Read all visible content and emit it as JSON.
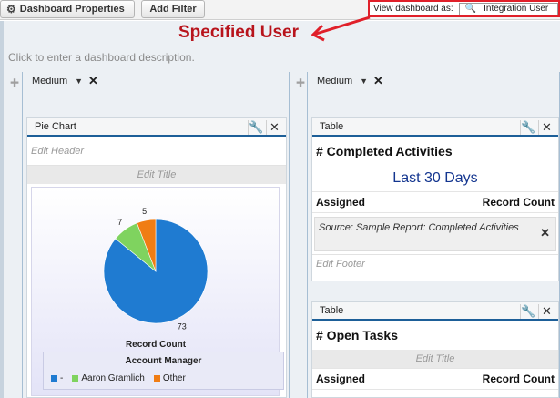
{
  "toolbar": {
    "dashboard_properties_label": "Dashboard Properties",
    "add_filter_label": "Add Filter",
    "view_as_label": "View dashboard as:",
    "view_as_value": "Integration User"
  },
  "annotation": {
    "label": "Specified User",
    "color": "#b8141c"
  },
  "dashboard": {
    "description_placeholder": "Click to enter a dashboard description.",
    "columns": [
      {
        "width_label": "Medium"
      },
      {
        "width_label": "Medium"
      }
    ]
  },
  "pie_component": {
    "type_label": "Pie Chart",
    "header_placeholder": "Edit Header",
    "title_placeholder": "Edit Title",
    "legend_title": "Account Manager",
    "bottom_label": "Record Count"
  },
  "chart_data": {
    "type": "pie",
    "categories": [
      "-",
      "Aaron Gramlich",
      "Other"
    ],
    "values": [
      73,
      7,
      5
    ],
    "colors": [
      "#1f7bd1",
      "#7fd35f",
      "#f07d14"
    ],
    "xlabel": "Record Count",
    "legend_title": "Account Manager"
  },
  "table_component_1": {
    "type_label": "Table",
    "title": "# Completed Activities",
    "subtitle": "Last 30 Days",
    "col1": "Assigned",
    "col2": "Record Count",
    "source": "Source: Sample Report: Completed Activities",
    "footer_placeholder": "Edit Footer"
  },
  "table_component_2": {
    "type_label": "Table",
    "title": "# Open Tasks",
    "title_placeholder": "Edit Title",
    "col1": "Assigned",
    "col2": "Record Count"
  }
}
